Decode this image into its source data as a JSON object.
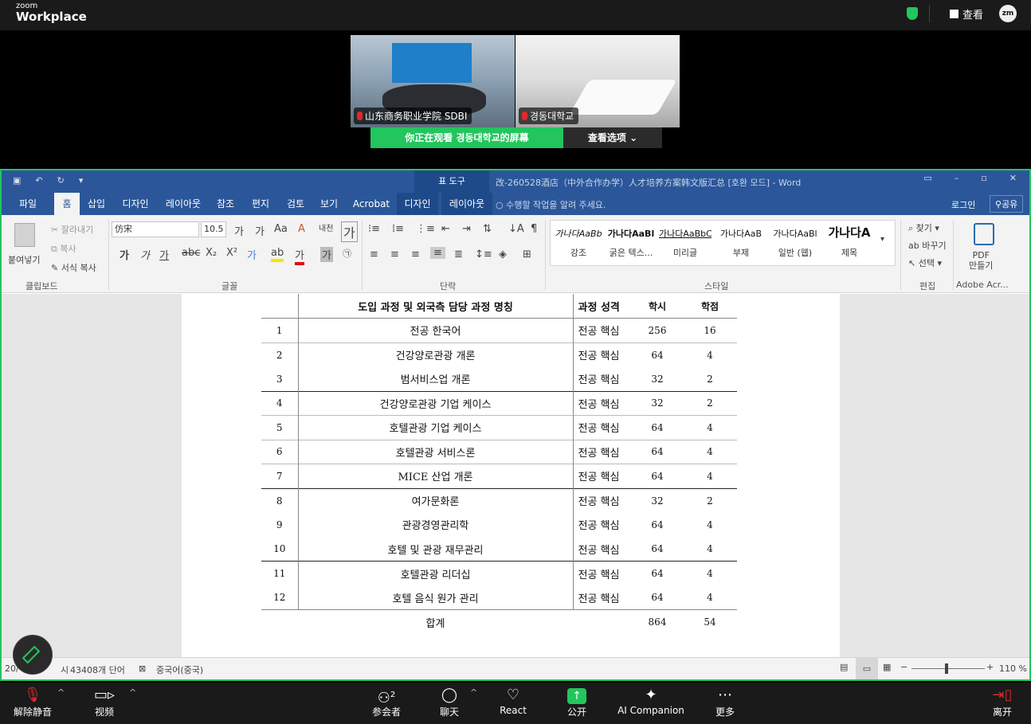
{
  "zoom": {
    "brand_line1": "zoom",
    "brand_line2": "Workplace",
    "view_label": "查看",
    "avatar_initials": "zm",
    "participants": [
      {
        "name": "山东商务职业学院 SDBI"
      },
      {
        "name": "경동대학교"
      }
    ],
    "viewing_banner": "你正在观看 경동대학교的屏幕",
    "view_options": "查看选项"
  },
  "word": {
    "table_tools_tab": "표 도구",
    "doc_title": "改-260528酒店（中外合作办学）人才培养方案韩文版汇总 [호환 모드] - Word",
    "tabs": [
      "파일",
      "홈",
      "삽입",
      "디자인",
      "레이아웃",
      "참조",
      "편지",
      "검토",
      "보기",
      "Acrobat",
      "디자인",
      "레이아웃"
    ],
    "tell_me": "수행할 작업을 알려 주세요.",
    "sign_in": "로그인",
    "share": "공유",
    "ribbon": {
      "paste": "붙여넣기",
      "cut": "잘라내기",
      "copy": "복사",
      "format_painter": "서식 복사",
      "clipboard_group": "클립보드",
      "font_name": "仿宋",
      "font_size": "10.5",
      "font_group": "글꼴",
      "paragraph_group": "단락",
      "styles": [
        {
          "preview": "가나다AaBb",
          "name": "강조"
        },
        {
          "preview": "가나다AaBl",
          "name": "굵은 텍스..."
        },
        {
          "preview": "가나다AaBbC",
          "name": "미리글"
        },
        {
          "preview": "가나다AaB",
          "name": "부제"
        },
        {
          "preview": "가나다AaBl",
          "name": "일반 (웹)"
        },
        {
          "preview": "가나다A",
          "name": "제목"
        }
      ],
      "styles_group": "스타일",
      "find": "찾기",
      "replace": "바꾸기",
      "select": "선택",
      "editing_group": "편집",
      "pdf_create": "PDF\n만들기",
      "adobe_group": "Adobe Acr..."
    },
    "table": {
      "headers": [
        "도입 과정 및 외국측 담당 과정 명칭",
        "과정 성격",
        "학시",
        "학점"
      ],
      "rows": [
        {
          "no": "1",
          "name": "전공 한국어",
          "type": "전공 핵심",
          "hours": "256",
          "credits": "16"
        },
        {
          "no": "2",
          "name": "건강양로관광 개론",
          "type": "전공 핵심",
          "hours": "64",
          "credits": "4"
        },
        {
          "no": "3",
          "name": "범서비스업 개론",
          "type": "전공 핵심",
          "hours": "32",
          "credits": "2"
        },
        {
          "no": "4",
          "name": "건강양로관광 기업 케이스",
          "type": "전공 핵심",
          "hours": "32",
          "credits": "2"
        },
        {
          "no": "5",
          "name": "호텔관광 기업 케이스",
          "type": "전공 핵심",
          "hours": "64",
          "credits": "4"
        },
        {
          "no": "6",
          "name": "호텔관광 서비스론",
          "type": "전공 핵심",
          "hours": "64",
          "credits": "4"
        },
        {
          "no": "7",
          "name": "MICE 산업 개론",
          "type": "전공 핵심",
          "hours": "64",
          "credits": "4"
        },
        {
          "no": "8",
          "name": "여가문화론",
          "type": "전공 핵심",
          "hours": "32",
          "credits": "2"
        },
        {
          "no": "9",
          "name": "관광경영관리학",
          "type": "전공 핵심",
          "hours": "64",
          "credits": "4"
        },
        {
          "no": "10",
          "name": "호텔 및 관광 재무관리",
          "type": "전공 핵심",
          "hours": "64",
          "credits": "4"
        },
        {
          "no": "11",
          "name": "호텔관광 리더십",
          "type": "전공 핵심",
          "hours": "64",
          "credits": "4"
        },
        {
          "no": "12",
          "name": "호텔 음식 원가 관리",
          "type": "전공 핵심",
          "hours": "64",
          "credits": "4"
        }
      ],
      "total_label": "합계",
      "total_hours": "864",
      "total_credits": "54"
    },
    "status": {
      "page": "20/",
      "words_prefix": "시",
      "word_count": "43408개 단어",
      "language": "중국어(중국)",
      "zoom_level": "110 %"
    }
  },
  "toolbar": {
    "mute": "解除静音",
    "video": "视频",
    "participants": "参会者",
    "participant_count": "2",
    "chat": "聊天",
    "react": "React",
    "share": "公开",
    "ai": "AI Companion",
    "more": "更多",
    "leave": "离开"
  },
  "colors": {
    "word_blue": "#2b579a",
    "zoom_green": "#22c55e"
  }
}
